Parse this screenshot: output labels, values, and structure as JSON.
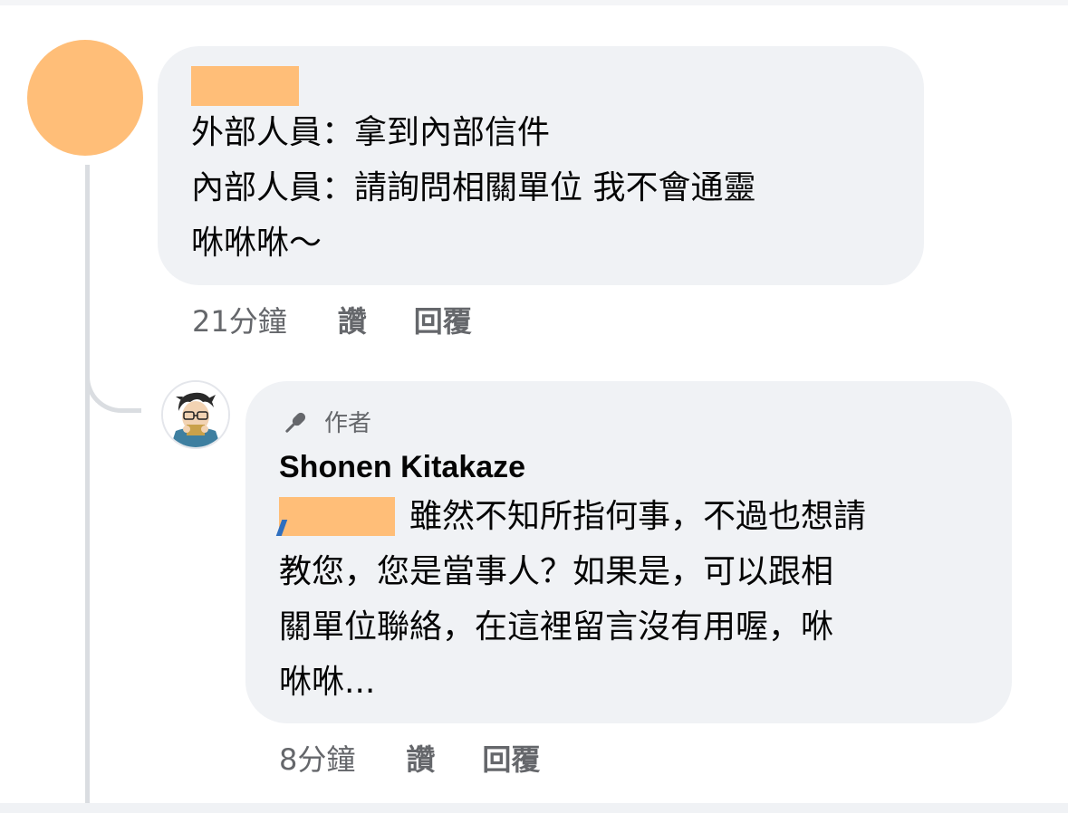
{
  "comment": {
    "lines": [
      "外部人員：拿到內部信件",
      "內部人員：請詢問相關單位 我不會通靈",
      "咻咻咻～"
    ],
    "actions": {
      "time": "21分鐘",
      "like": "讚",
      "reply": "回覆"
    }
  },
  "reply": {
    "badge": {
      "icon": "microphone-icon",
      "label": "作者"
    },
    "author": "Shonen Kitakaze",
    "lines": [
      "雖然不知所指何事，不過也想請",
      "教您，您是當事人？如果是，可以跟相",
      "關單位聯絡，在這裡留言沒有用喔，咻",
      "咻咻..."
    ],
    "actions": {
      "time": "8分鐘",
      "like": "讚",
      "reply": "回覆"
    }
  },
  "colors": {
    "bubble": "#f0f2f5",
    "redaction": "#ffbe78",
    "secondary_text": "#65676b",
    "thread_line": "#dadde1"
  }
}
